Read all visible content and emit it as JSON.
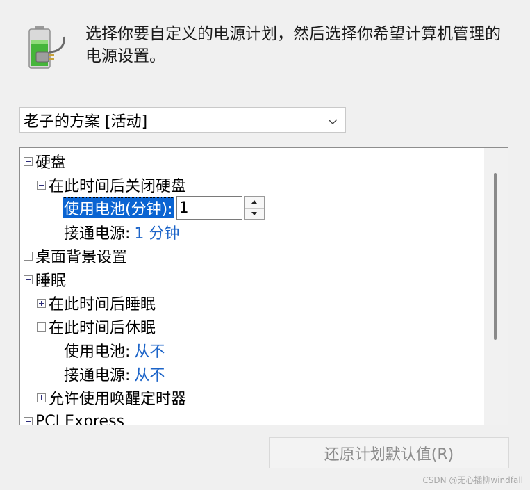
{
  "header": {
    "icon": "battery-power-plug-icon",
    "instruction": "选择你要自定义的电源计划，然后选择你希望计算机管理的电源设置。"
  },
  "plan_select": {
    "selected": "老子的方案 [活动]",
    "icon": "chevron-down-icon"
  },
  "tree": {
    "hard_disk": "硬盘",
    "turn_off_disk_after": "在此时间后关闭硬盘",
    "on_battery_minutes": "使用电池(分钟):",
    "on_battery_value": "1",
    "plugged_in_label": "接通电源:",
    "plugged_in_value": "1 分钟",
    "desktop_background": "桌面背景设置",
    "sleep": "睡眠",
    "sleep_after": "在此时间后睡眠",
    "hibernate_after": "在此时间后休眠",
    "hib_battery_label": "使用电池:",
    "hib_battery_value": "从不",
    "hib_plugged_label": "接通电源:",
    "hib_plugged_value": "从不",
    "wake_timers": "允许使用唤醒定时器",
    "pci_express": "PCI Express"
  },
  "restore_button": "还原计划默认值(R)",
  "watermark": "CSDN @无心插柳windfall"
}
